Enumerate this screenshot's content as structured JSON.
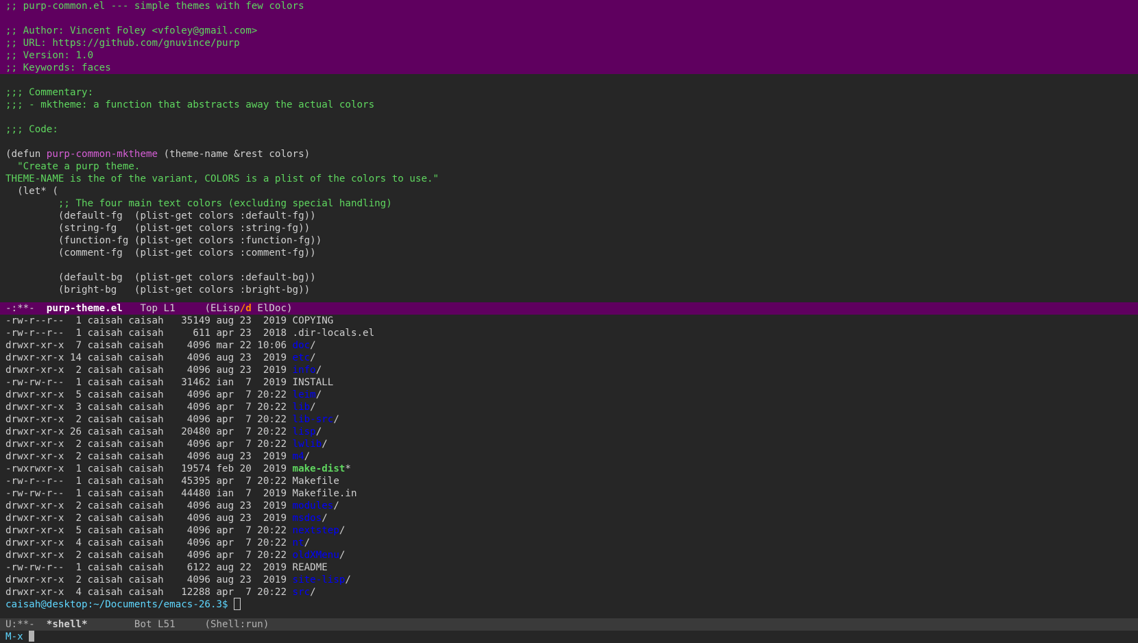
{
  "editor": {
    "header_lines": [
      ";; purp-common.el --- simple themes with few colors",
      "",
      ";; Author: Vincent Foley <vfoley@gmail.com>",
      ";; URL: https://github.com/gnuvince/purp",
      ";; Version: 1.0",
      ";; Keywords: faces"
    ],
    "commentary_label": ";;; Commentary:",
    "commentary_item": ";;; - mktheme: a function that abstracts away the actual colors",
    "code_label": ";;; Code:",
    "defun_keyword": "(defun ",
    "defun_name": "purp-common-mktheme",
    "defun_args": " (theme-name &rest colors)",
    "docstring_1": "  \"Create a purp theme.",
    "docstring_2": "THEME-NAME is the of the variant, COLORS is a plist of the colors to use.\"",
    "let_line": "  (let* (",
    "let_comment": "         ;; The four main text colors (excluding special handling)",
    "bindings_1": [
      "         (default-fg  (plist-get colors :default-fg))",
      "         (string-fg   (plist-get colors :string-fg))",
      "         (function-fg (plist-get colors :function-fg))",
      "         (comment-fg  (plist-get colors :comment-fg))"
    ],
    "bindings_2": [
      "         (default-bg  (plist-get colors :default-bg))",
      "         (bright-bg   (plist-get colors :bright-bg))"
    ]
  },
  "modeline_top": {
    "status": "-:**-  ",
    "buffer_name": "purp-theme.el",
    "position": "   Top L1     ",
    "mode_open": "(ELisp",
    "mode_d": "/d",
    "mode_rest": " ElDoc)"
  },
  "shell": {
    "entries": [
      {
        "info": "-rw-r--r--  1 caisah caisah   35149 aug 23  2019 ",
        "name": "COPYING",
        "kind": "file"
      },
      {
        "info": "-rw-r--r--  1 caisah caisah     611 apr 23  2018 ",
        "name": ".dir-locals.el",
        "kind": "file"
      },
      {
        "info": "drwxr-xr-x  7 caisah caisah    4096 mar 22 10:06 ",
        "name": "doc",
        "kind": "dir"
      },
      {
        "info": "drwxr-xr-x 14 caisah caisah    4096 aug 23  2019 ",
        "name": "etc",
        "kind": "dir"
      },
      {
        "info": "drwxr-xr-x  2 caisah caisah    4096 aug 23  2019 ",
        "name": "info",
        "kind": "dir"
      },
      {
        "info": "-rw-rw-r--  1 caisah caisah   31462 ian  7  2019 ",
        "name": "INSTALL",
        "kind": "file"
      },
      {
        "info": "drwxr-xr-x  5 caisah caisah    4096 apr  7 20:22 ",
        "name": "leim",
        "kind": "dir"
      },
      {
        "info": "drwxr-xr-x  3 caisah caisah    4096 apr  7 20:22 ",
        "name": "lib",
        "kind": "dir"
      },
      {
        "info": "drwxr-xr-x  2 caisah caisah    4096 apr  7 20:22 ",
        "name": "lib-src",
        "kind": "dir"
      },
      {
        "info": "drwxr-xr-x 26 caisah caisah   20480 apr  7 20:22 ",
        "name": "lisp",
        "kind": "dir"
      },
      {
        "info": "drwxr-xr-x  2 caisah caisah    4096 apr  7 20:22 ",
        "name": "lwlib",
        "kind": "dir"
      },
      {
        "info": "drwxr-xr-x  2 caisah caisah    4096 aug 23  2019 ",
        "name": "m4",
        "kind": "dir"
      },
      {
        "info": "-rwxrwxr-x  1 caisah caisah   19574 feb 20  2019 ",
        "name": "make-dist",
        "kind": "exe"
      },
      {
        "info": "-rw-r--r--  1 caisah caisah   45395 apr  7 20:22 ",
        "name": "Makefile",
        "kind": "file"
      },
      {
        "info": "-rw-rw-r--  1 caisah caisah   44480 ian  7  2019 ",
        "name": "Makefile.in",
        "kind": "file"
      },
      {
        "info": "drwxr-xr-x  2 caisah caisah    4096 aug 23  2019 ",
        "name": "modules",
        "kind": "dir"
      },
      {
        "info": "drwxr-xr-x  2 caisah caisah    4096 aug 23  2019 ",
        "name": "msdos",
        "kind": "dir"
      },
      {
        "info": "drwxr-xr-x  5 caisah caisah    4096 apr  7 20:22 ",
        "name": "nextstep",
        "kind": "dir"
      },
      {
        "info": "drwxr-xr-x  4 caisah caisah    4096 apr  7 20:22 ",
        "name": "nt",
        "kind": "dir"
      },
      {
        "info": "drwxr-xr-x  2 caisah caisah    4096 apr  7 20:22 ",
        "name": "oldXMenu",
        "kind": "dir"
      },
      {
        "info": "-rw-rw-r--  1 caisah caisah    6122 aug 22  2019 ",
        "name": "README",
        "kind": "file"
      },
      {
        "info": "drwxr-xr-x  2 caisah caisah    4096 aug 23  2019 ",
        "name": "site-lisp",
        "kind": "dir"
      },
      {
        "info": "drwxr-xr-x  4 caisah caisah   12288 apr  7 20:22 ",
        "name": "src",
        "kind": "dir"
      }
    ],
    "prompt": "caisah@desktop:~/Documents/emacs-26.3$ "
  },
  "modeline_bottom": {
    "status": "U:**-  ",
    "buffer_name": "*shell*",
    "position": "        Bot L51     ",
    "mode": "(Shell:run)"
  },
  "minibuffer": {
    "prompt": "M-x"
  },
  "colors": {
    "background": "#262626",
    "header_highlight": "#5f005f",
    "comment": "#5fd75f",
    "function_name": "#d75fd7",
    "directory": "#0000ff",
    "executable": "#5fd75f"
  }
}
